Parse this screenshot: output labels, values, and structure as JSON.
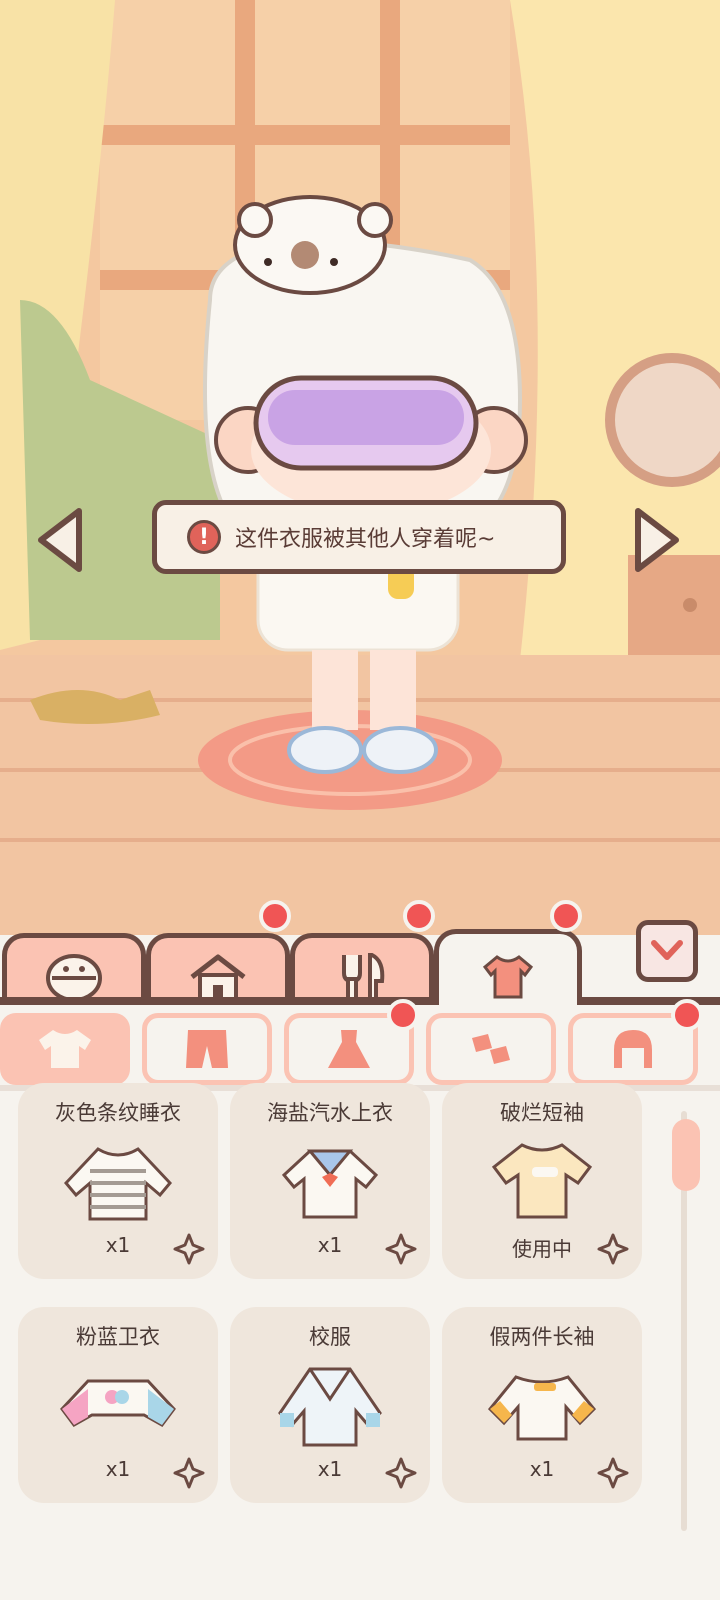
{
  "toast": {
    "message": "这件衣服被其他人穿着呢~"
  },
  "main_tabs": [
    {
      "icon": "face-icon",
      "badge": false
    },
    {
      "icon": "house-icon",
      "badge": true
    },
    {
      "icon": "utensils-icon",
      "badge": true
    },
    {
      "icon": "shirt-icon",
      "badge": true,
      "active": true
    }
  ],
  "sub_tabs": [
    {
      "icon": "top-icon",
      "active": true,
      "badge": false
    },
    {
      "icon": "pants-icon",
      "badge": false
    },
    {
      "icon": "dress-icon",
      "badge": true
    },
    {
      "icon": "shoes-icon",
      "badge": false
    },
    {
      "icon": "hair-icon",
      "badge": true
    }
  ],
  "items": [
    {
      "name": "灰色条纹睡衣",
      "status": "x1"
    },
    {
      "name": "海盐汽水上衣",
      "status": "x1"
    },
    {
      "name": "破烂短袖",
      "status": "使用中"
    },
    {
      "name": "粉蓝卫衣",
      "status": "x1"
    },
    {
      "name": "校服",
      "status": "x1"
    },
    {
      "name": "假两件长袖",
      "status": "x1"
    }
  ],
  "colors": {
    "accent": "#fbc3b3",
    "outline": "#6b4a42",
    "badge": "#f05555"
  }
}
